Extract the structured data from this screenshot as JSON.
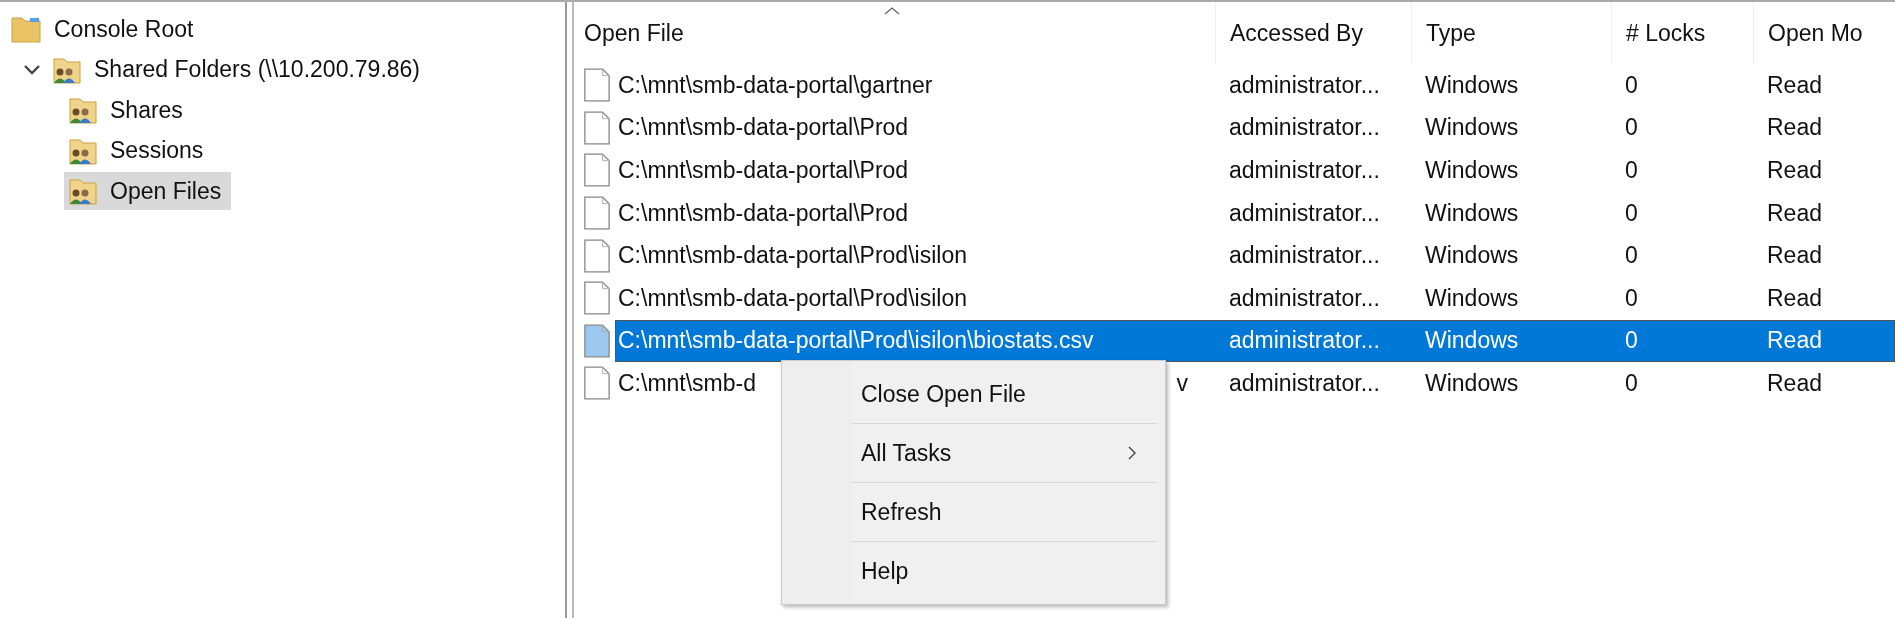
{
  "tree": [
    {
      "label": "Console Root",
      "selected": false,
      "children": [
        {
          "label": "Shared Folders (\\\\10.200.79.86)",
          "selected": false,
          "expanded": true,
          "children": [
            {
              "label": "Shares",
              "selected": false
            },
            {
              "label": "Sessions",
              "selected": false
            },
            {
              "label": "Open Files",
              "selected": true
            }
          ]
        }
      ]
    }
  ],
  "table": {
    "columns": [
      "Open File",
      "Accessed By",
      "Type",
      "# Locks",
      "Open Mo"
    ],
    "rows": [
      {
        "open_file": "C:\\mnt\\smb-data-portal\\gartner",
        "accessed_by": "administrator...",
        "type": "Windows",
        "locks": "0",
        "open_mode": "Read",
        "selected": false
      },
      {
        "open_file": "C:\\mnt\\smb-data-portal\\Prod",
        "accessed_by": "administrator...",
        "type": "Windows",
        "locks": "0",
        "open_mode": "Read",
        "selected": false
      },
      {
        "open_file": "C:\\mnt\\smb-data-portal\\Prod",
        "accessed_by": "administrator...",
        "type": "Windows",
        "locks": "0",
        "open_mode": "Read",
        "selected": false
      },
      {
        "open_file": "C:\\mnt\\smb-data-portal\\Prod",
        "accessed_by": "administrator...",
        "type": "Windows",
        "locks": "0",
        "open_mode": "Read",
        "selected": false
      },
      {
        "open_file": "C:\\mnt\\smb-data-portal\\Prod\\isilon",
        "accessed_by": "administrator...",
        "type": "Windows",
        "locks": "0",
        "open_mode": "Read",
        "selected": false
      },
      {
        "open_file": "C:\\mnt\\smb-data-portal\\Prod\\isilon",
        "accessed_by": "administrator...",
        "type": "Windows",
        "locks": "0",
        "open_mode": "Read",
        "selected": false
      },
      {
        "open_file": "C:\\mnt\\smb-data-portal\\Prod\\isilon\\biostats.csv",
        "accessed_by": "administrator...",
        "type": "Windows",
        "locks": "0",
        "open_mode": "Read",
        "selected": true
      },
      {
        "open_file": "C:\\mnt\\smb-d",
        "open_file_tail": "v",
        "accessed_by": "administrator...",
        "type": "Windows",
        "locks": "0",
        "open_mode": "Read",
        "selected": false
      }
    ]
  },
  "context_menu": {
    "items": [
      {
        "label": "Close Open File",
        "submenu": false
      },
      {
        "label": "All Tasks",
        "submenu": true
      },
      {
        "label": "Refresh",
        "submenu": false
      },
      {
        "label": "Help",
        "submenu": false
      }
    ]
  }
}
